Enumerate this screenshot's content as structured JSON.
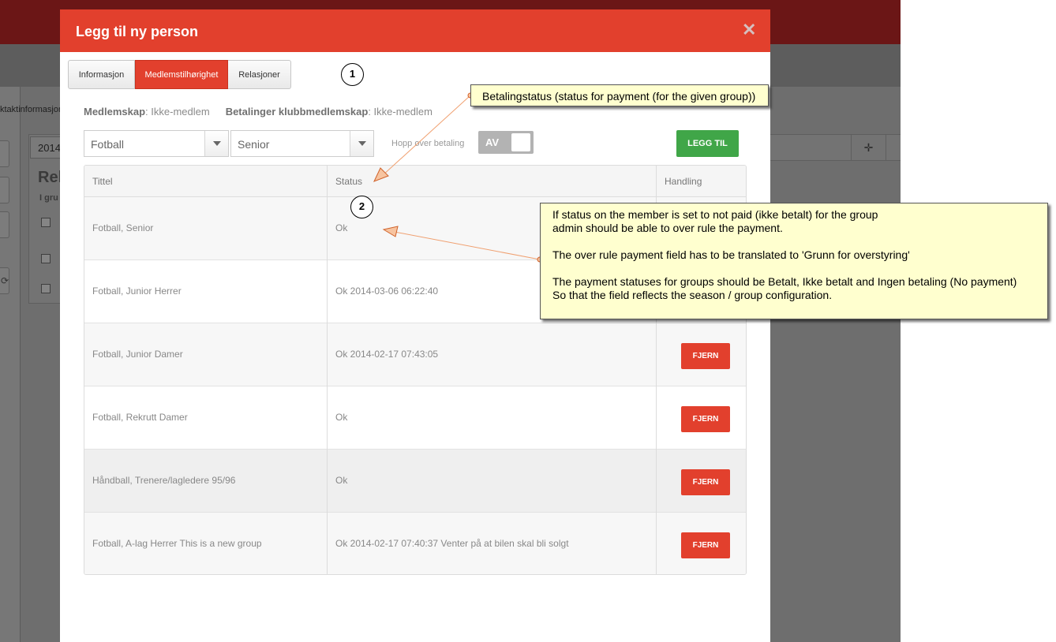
{
  "background": {
    "tab_fragment": "ktaktinformasjon",
    "year_fragment": "2014",
    "title_fragment": "Rel",
    "group_fragment": "I gru"
  },
  "modal": {
    "title": "Legg til ny person",
    "close_icon": "close-icon",
    "tabs": [
      {
        "label": "Informasjon",
        "active": false
      },
      {
        "label": "Medlemstilhørighet",
        "active": true
      },
      {
        "label": "Relasjoner",
        "active": false
      }
    ],
    "summary": {
      "membership_label": "Medlemskap",
      "membership_value": ": Ikke-medlem",
      "payments_label": "Betalinger klubbmedlemskap",
      "payments_value": ": Ikke-medlem"
    },
    "form": {
      "sport_value": "Fotball",
      "group_value": "Senior",
      "skip_payment_label": "Hopp over betaling",
      "toggle_text": "AV",
      "add_label": "LEGG TIL"
    },
    "table": {
      "headers": [
        "Tittel",
        "Status",
        "Handling"
      ],
      "rows": [
        {
          "title": "Fotball, Senior",
          "status": "Ok",
          "action": ""
        },
        {
          "title": "Fotball, Junior Herrer",
          "status": "Ok 2014-03-06 06:22:40",
          "action": ""
        },
        {
          "title": "Fotball, Junior Damer",
          "status": "Ok 2014-02-17 07:43:05",
          "action": "FJERN"
        },
        {
          "title": "Fotball, Rekrutt Damer",
          "status": "Ok",
          "action": "FJERN"
        },
        {
          "title": "Håndball, Trenere/lagledere 95/96",
          "status": "Ok",
          "action": "FJERN"
        },
        {
          "title": "Fotball, A-lag Herrer This is a new group",
          "status": "Ok 2014-02-17 07:40:37 Venter på at bilen skal bli solgt",
          "action": "FJERN"
        }
      ]
    }
  },
  "annotations": {
    "marker1": "1",
    "marker2": "2",
    "note1": "Betalingstatus  (status for payment (for the given group))",
    "note2": {
      "line1": "If status on the member is set to not paid (ikke betalt) for the group",
      "line2": "admin should be able to over rule the payment.",
      "line3": "The over rule payment field has to be translated to 'Grunn for overstyring'",
      "line4": "The payment statuses for groups should be Betalt, Ikke betalt and Ingen betaling (No payment)",
      "line5": "So that the field reflects the season / group configuration."
    }
  },
  "colors": {
    "accent": "#e2402d",
    "success": "#40a648",
    "note_bg": "#ffffcf"
  }
}
